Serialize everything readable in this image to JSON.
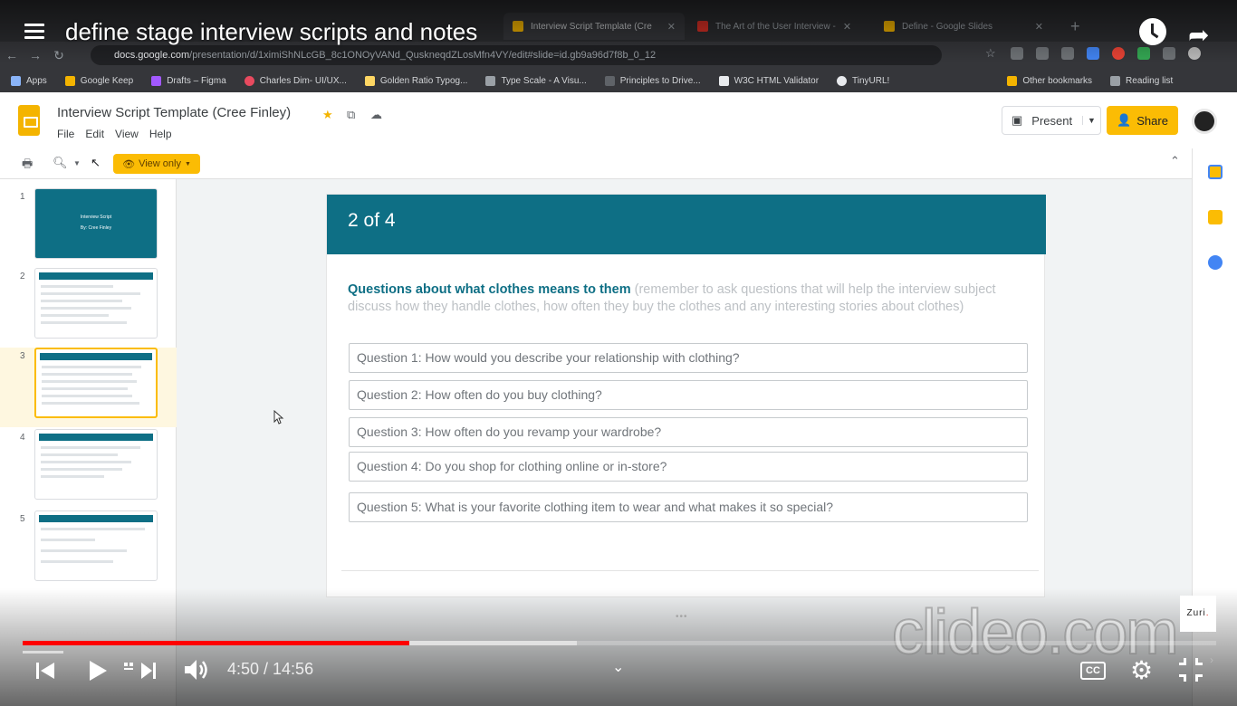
{
  "browser": {
    "tabs": [
      {
        "label": "Interview Script Template (Cre",
        "active": true
      },
      {
        "label": "The Art of the User Interview -",
        "active": false
      },
      {
        "label": "Define - Google Slides",
        "active": false
      }
    ],
    "url_host": "docs.google.com",
    "url_path": "/presentation/d/1ximiShNLcGB_8c1ONOyVANd_QuskneqdZLosMfn4VY/edit#slide=id.gb9a96d7f8b_0_12",
    "bookmarks": [
      "Apps",
      "Google Keep",
      "Drafts – Figma",
      "Charles Dim- UI/UX...",
      "Golden Ratio Typog...",
      "Type Scale - A Visu...",
      "Principles to Drive...",
      "W3C HTML Validator",
      "TinyURL!",
      "Other bookmarks",
      "Reading list"
    ]
  },
  "slides_app": {
    "doc_title": "Interview Script Template (Cree Finley)",
    "menus": [
      "File",
      "Edit",
      "View",
      "Help"
    ],
    "present_label": "Present",
    "share_label": "Share",
    "view_only_label": "View only",
    "thumb_numbers": [
      "1",
      "2",
      "3",
      "4",
      "5"
    ],
    "cover_title": "Interview Script",
    "cover_subtitle": "By: Cree Finley"
  },
  "slide": {
    "header": "2 of 4",
    "intro_bold": "Questions about what clothes means to them",
    "intro_rest": " (remember to ask questions that will help the interview subject discuss how they handle clothes, how often they buy the clothes and any interesting stories about clothes)",
    "questions": [
      "Question 1: How would you describe your relationship with clothing?",
      "Question 2: How often do you buy clothing?",
      "Question 3: How often do you revamp your wardrobe?",
      "Question 4: Do you shop for clothing online or in-store?",
      "Question 5: What is your favorite clothing item to wear and what makes it so special?"
    ]
  },
  "player": {
    "video_title": "define stage interview scripts and notes",
    "current_time": "4:50",
    "duration": "14:56",
    "time_display": "4:50 / 14:56",
    "played_fraction": 0.324,
    "buffered_fraction": 0.464,
    "cc_label": "CC",
    "watermark": "clideo.com",
    "channel_badge_text": "Zuri",
    "colors": {
      "progress": "#ff0000",
      "slide_accent": "#0e6f85",
      "share_button": "#fbbc04"
    }
  }
}
